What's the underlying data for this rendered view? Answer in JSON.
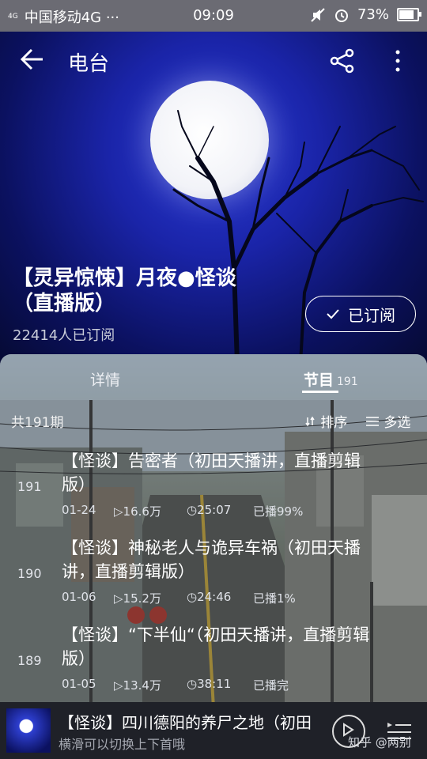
{
  "status": {
    "signal": "4G",
    "carrier": "中国移动4G ···",
    "time": "09:09",
    "battery": "73%",
    "battery_level": 0.73
  },
  "header": {
    "title": "电台"
  },
  "program": {
    "title": "【灵异惊悚】月夜●怪谈（直播版）",
    "subscribers": "22414人已订阅",
    "subscribe_label": "已订阅"
  },
  "tabs": {
    "detail": "详情",
    "programs": "节目",
    "programs_count": "191"
  },
  "list": {
    "total": "共191期",
    "sort": "排序",
    "multi_select": "多选",
    "episodes": [
      {
        "num": "191",
        "title": "【怪谈】告密者（初田天播讲，直播剪辑版）",
        "date": "01-24",
        "plays": "16.6万",
        "duration": "25:07",
        "status": "已播99%"
      },
      {
        "num": "190",
        "title": "【怪谈】神秘老人与诡异车祸（初田天播讲，直播剪辑版）",
        "date": "01-06",
        "plays": "15.2万",
        "duration": "24:46",
        "status": "已播1%"
      },
      {
        "num": "189",
        "title": "【怪谈】“下半仙“（初田天播讲，直播剪辑版）",
        "date": "01-05",
        "plays": "13.4万",
        "duration": "38:11",
        "status": "已播完"
      }
    ]
  },
  "player": {
    "title": "【怪谈】四川德阳的养尸之地（初田",
    "hint": "横滑可以切换上下首哦"
  },
  "watermark": "知乎 @两别"
}
